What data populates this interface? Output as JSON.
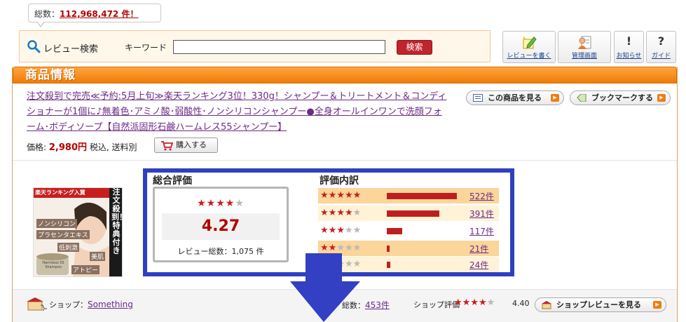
{
  "header": {
    "total_label": "総数：",
    "total_count": "112,968,472 件！"
  },
  "search": {
    "title": "レビュー検索",
    "keyword_label": "キーワード",
    "keyword_value": "",
    "button_label": "検索"
  },
  "nav": [
    {
      "label": "レビューを書く",
      "icon": "pencil-note-icon"
    },
    {
      "label": "管理画面",
      "icon": "user-profile-icon"
    },
    {
      "label": "お知らせ",
      "icon": "exclamation-icon"
    },
    {
      "label": "ガイド",
      "icon": "question-icon"
    }
  ],
  "panel": {
    "title": "商品情報",
    "product_name": "注文殺到で完売≪予約:5月上旬≫楽天ランキング3位！330g！シャンプー＆トリートメント＆コンディショナーが1個に♪無着色･アミノ酸･弱酸性･ノンシリコンシャンプー●全身オールインワンで洗顔フォーム･ボディソープ【自然派固形石鹸ハームレス55シャンプー】",
    "price_label": "価格:",
    "price": "2,980円",
    "price_note": "税込, 送料別",
    "buy_label": "購入する",
    "view_item_label": "この商品を見る",
    "bookmark_label": "ブックマークする"
  },
  "product_image": {
    "ribbon": "楽天ランキング入賞",
    "side_text": "注文殺到！特典付き",
    "tags": [
      "ノンシリコン",
      "プラセンタエキス",
      "低刺激",
      "美肌",
      "アトピー"
    ],
    "jar_label": "Harmless 55 Shampoo"
  },
  "rating": {
    "overall_title": "総合評価",
    "breakdown_title": "評価内訳",
    "score": "4.27",
    "score_value": 4.27,
    "review_total": "レビュー総数：1,075 件",
    "breakdown": [
      {
        "stars": 5,
        "count": "522件",
        "value": 522
      },
      {
        "stars": 4,
        "count": "391件",
        "value": 391
      },
      {
        "stars": 3,
        "count": "117件",
        "value": 117
      },
      {
        "stars": 2,
        "count": "21件",
        "value": 21
      },
      {
        "stars": 1,
        "count": "24件",
        "value": 24
      }
    ]
  },
  "shop": {
    "label": "ショップ：",
    "name": "Something",
    "reviews_label": "総数：",
    "reviews_count": "453件",
    "eval_label": "ショップ評価",
    "score": "4.40",
    "score_value": 4.4,
    "button_label": "ショップレビューを見る"
  },
  "colors": {
    "accent_orange": "#f07c08",
    "star_red": "#c81e1e",
    "highlight_blue": "#2f3fc0",
    "link_purple": "#6b2a86"
  }
}
